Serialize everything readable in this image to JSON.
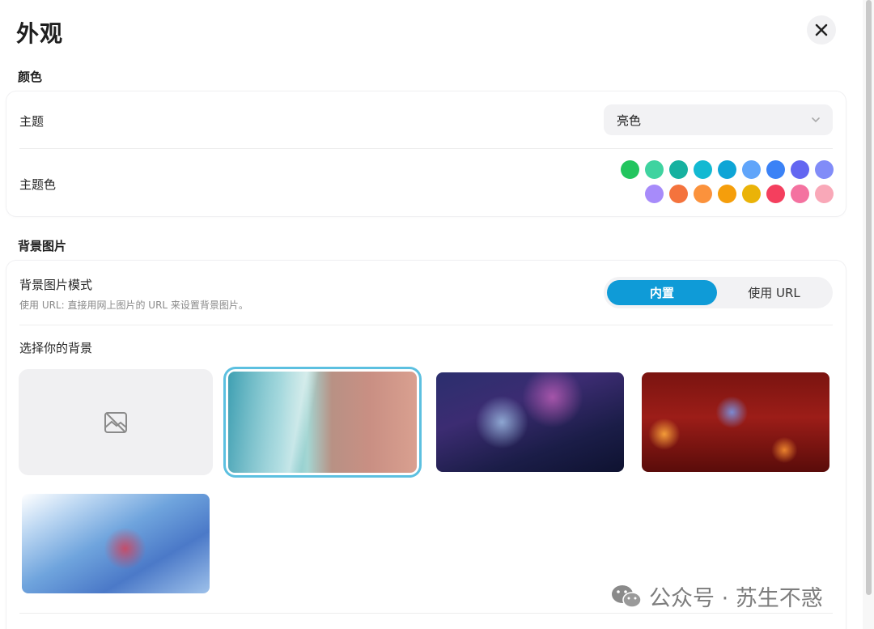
{
  "dialog": {
    "title": "外观",
    "close_icon": "close-icon"
  },
  "color_section": {
    "heading": "颜色",
    "theme_label": "主题",
    "theme_value": "亮色",
    "accent_label": "主题色",
    "swatches_row1": [
      "#22c55e",
      "#3fd3a0",
      "#16b1a0",
      "#13b9d2",
      "#0ea5d6",
      "#60a5fa",
      "#3b82f6",
      "#6366f1",
      "#818cf8"
    ],
    "swatches_row2": [
      "#a78bfa",
      "#f4733d",
      "#fb923c",
      "#f59e0b",
      "#eab308",
      "#f43f5e",
      "#f472a0",
      "#f9a8b8"
    ]
  },
  "bg_section": {
    "heading": "背景图片",
    "mode_label": "背景图片模式",
    "mode_description": "使用 URL: 直接用网上图片的 URL 来设置背景图片。",
    "mode_options": [
      "内置",
      "使用 URL"
    ],
    "selected_mode": "内置",
    "choose_label": "选择你的背景",
    "selected_index": 1
  },
  "colors": {
    "accent": "#0f9bd7",
    "selected_border": "#5cc0e0"
  },
  "watermark": {
    "text": "公众号 · 苏生不惑"
  }
}
